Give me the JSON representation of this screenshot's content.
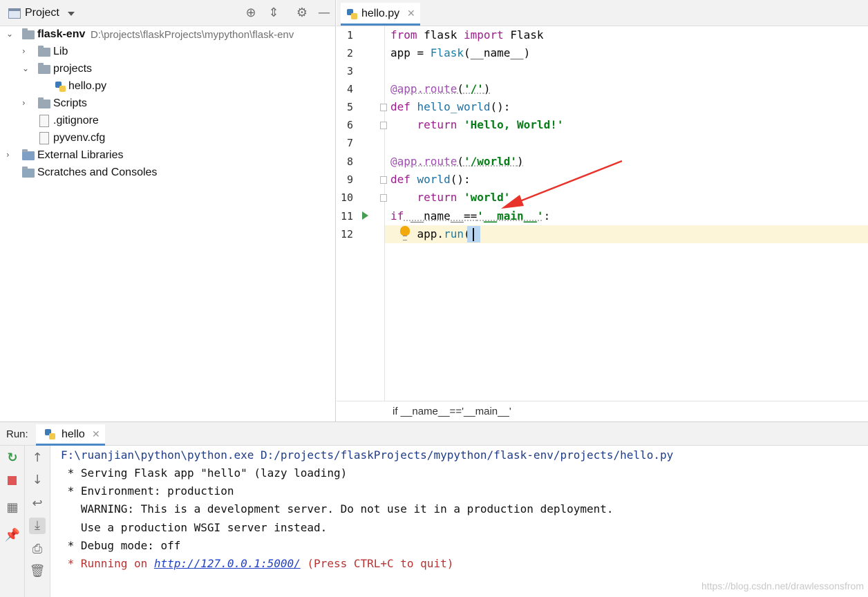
{
  "project_panel": {
    "title": "Project",
    "tree": {
      "root_name": "flask-env",
      "root_path": "D:\\projects\\flaskProjects\\mypython\\flask-env",
      "lib": "Lib",
      "projects": "projects",
      "hello_file": "hello.py",
      "scripts": "Scripts",
      "gitignore": ".gitignore",
      "pyvenv": "pyvenv.cfg",
      "external_libraries": "External Libraries",
      "scratches": "Scratches and Consoles"
    }
  },
  "editor": {
    "tab_label": "hello.py",
    "line_numbers": [
      "1",
      "2",
      "3",
      "4",
      "5",
      "6",
      "7",
      "8",
      "9",
      "10",
      "11",
      "12"
    ],
    "code": {
      "l1_kw1": "from",
      "l1_mod": " flask ",
      "l1_kw2": "import",
      "l1_name": " Flask",
      "l2_var": "app = ",
      "l2_call": "Flask",
      "l2_rest": "(__name__)",
      "l4_deco": "@app.route",
      "l4_open": "(",
      "l4_str": "'/'",
      "l4_close": ")",
      "l5_kw": "def",
      "l5_fn": " hello_world",
      "l5_rest": "():",
      "l6_kw": "    return ",
      "l6_str": "'Hello, World!'",
      "l8_deco": "@app.route",
      "l8_open": "(",
      "l8_str": "'/world'",
      "l8_close": ")",
      "l9_kw": "def",
      "l9_fn": " world",
      "l9_rest": "():",
      "l10_kw": "    return ",
      "l10_str": "'world'",
      "l11_kw": "if",
      "l11_mid": " __name__==",
      "l11_str": "'__main__'",
      "l11_end": ":",
      "l12_obj": "    app.",
      "l12_call": "run",
      "l12_paren": "()"
    },
    "breadcrumb": "if __name__=='__main__'"
  },
  "run_panel": {
    "label": "Run:",
    "tab_label": "hello",
    "console": {
      "line1": "F:\\ruanjian\\python\\python.exe D:/projects/flaskProjects/mypython/flask-env/projects/hello.py",
      "line2": " * Serving Flask app \"hello\" (lazy loading)",
      "line3": " * Environment: production",
      "line4": "   WARNING: This is a development server. Do not use it in a production deployment.",
      "line5": "   Use a production WSGI server instead.",
      "line6": " * Debug mode: off",
      "line7_prefix": " * Running on ",
      "line7_link": "http://127.0.0.1:5000/",
      "line7_suffix": " (Press CTRL+C to quit)"
    }
  },
  "watermark": "https://blog.csdn.net/drawlessonsfrom",
  "colors": {
    "keyword": "#9b1c8b",
    "string": "#067d17",
    "current_line": "#fcf5d8",
    "annotation_arrow": "#e8332b",
    "stop": "#e05555",
    "rerun": "#3a9a4b"
  }
}
